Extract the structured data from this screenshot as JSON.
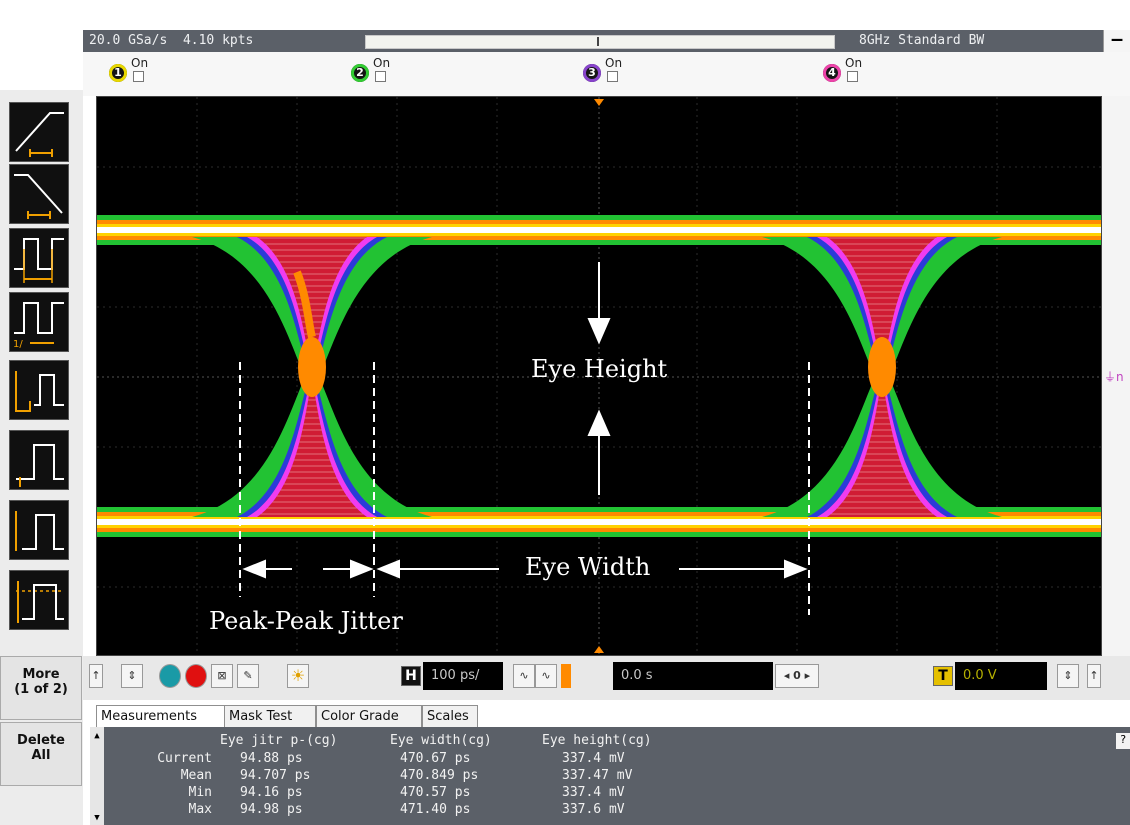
{
  "top_bar": {
    "sample_rate": "20.0 GSa/s",
    "memory_depth": "4.10 kpts",
    "bandwidth": "8GHz Standard BW",
    "minimize_label": "–"
  },
  "channels": [
    {
      "number": "1",
      "label": "On",
      "color": "#e8d800"
    },
    {
      "number": "2",
      "label": "On",
      "color": "#33cc33"
    },
    {
      "number": "3",
      "label": "On",
      "color": "#8844cc"
    },
    {
      "number": "4",
      "label": "On",
      "color": "#ee44aa"
    }
  ],
  "left_toolbar": {
    "tools": [
      "rise-time-icon",
      "fall-time-icon",
      "period-icon",
      "frequency-icon",
      "pulse-width-icon",
      "amplitude-icon",
      "top-base-icon",
      "overshoot-icon"
    ],
    "more_label": "More",
    "more_sub": "(1 of 2)",
    "delete_label": "Delete",
    "delete_sub": "All"
  },
  "display": {
    "eye_height_label": "Eye Height",
    "eye_width_label": "Eye Width",
    "jitter_label": "Peak-Peak Jitter",
    "colors": {
      "core": "#d01c34",
      "outer": "#22c233",
      "edge": "#f03cf0",
      "hot": "#ffd200",
      "white": "#ffffff",
      "orange": "#ff8a00"
    }
  },
  "control_bar": {
    "horizontal_badge": "H",
    "horizontal_scale": "100 ps/",
    "delay": "0.0 s",
    "reference_value": "0",
    "trigger_badge": "T",
    "trigger_level": "0.0 V"
  },
  "tabs": [
    {
      "label": "Measurements",
      "active": true
    },
    {
      "label": "Mask Test",
      "active": false
    },
    {
      "label": "Color Grade",
      "active": false
    },
    {
      "label": "Scales",
      "active": false
    }
  ],
  "measurements": {
    "columns": [
      "Eye jitr p-(cg)",
      "Eye width(cg)",
      "Eye height(cg)"
    ],
    "rows": [
      {
        "label": "Current",
        "values": [
          "94.88 ps",
          "470.67 ps",
          "337.4 mV"
        ]
      },
      {
        "label": "Mean",
        "values": [
          "94.707 ps",
          "470.849 ps",
          "337.47 mV"
        ]
      },
      {
        "label": "Min",
        "values": [
          "94.16 ps",
          "470.57 ps",
          "337.4 mV"
        ]
      },
      {
        "label": "Max",
        "values": [
          "94.98 ps",
          "471.40 ps",
          "337.6 mV"
        ]
      }
    ],
    "help_label": "?"
  }
}
